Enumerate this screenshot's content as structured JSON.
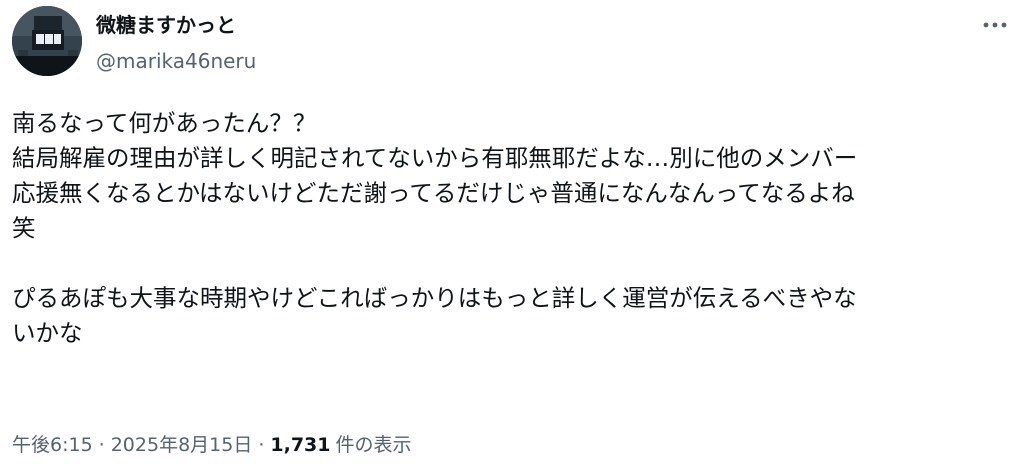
{
  "author": {
    "display_name": "微糖ますかっと",
    "handle": "@marika46neru",
    "avatar_icon": "profile-photo-stage-icon"
  },
  "menu": {
    "more_icon": "more-horizontal-icon"
  },
  "tweet": {
    "paragraph1": [
      "南るなって何があったん？？",
      "結局解雇の理由が詳しく明記されてないから有耶無耶だよな…別に他のメンバー",
      "応援無くなるとかはないけどただ謝ってるだけじゃ普通になんなんってなるよね",
      "笑"
    ],
    "paragraph2": [
      "ぴるあぽも大事な時期やけどこればっかりはもっと詳しく運営が伝えるべきやな",
      "いかな"
    ]
  },
  "meta": {
    "time": "午後6:15",
    "separator": "·",
    "date": "2025年8月15日",
    "views_count": "1,731",
    "views_label": "件の表示"
  },
  "colors": {
    "text": "#0f1419",
    "secondary": "#536471"
  }
}
